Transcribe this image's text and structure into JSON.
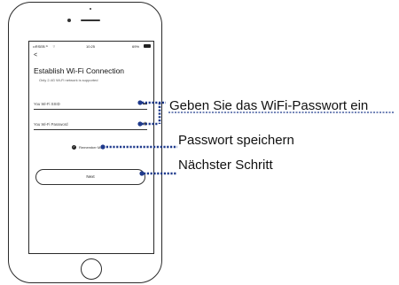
{
  "status_bar": {
    "carrier": "••RSEB ᴳ",
    "wifi": "⌔",
    "time": "10:25",
    "battery_pct": "69%"
  },
  "screen": {
    "back_label": "<",
    "title": "Establish Wi-Fi Connection",
    "subtitle": "Only 2.4G Wi-Fi network is supported",
    "ssid_placeholder": "You Wi-Fi SSID",
    "password_placeholder": "You Wi-Fi Password",
    "remember_label": "Remember Me",
    "next_label": "Next"
  },
  "callouts": {
    "password_hint": "Geben Sie das WiFi-Passwort ein",
    "save_password": "Passwort speichern",
    "next_step": "Nächster Schritt"
  },
  "colors": {
    "line": "#2a2a2a",
    "leader": "#1f3a8c"
  }
}
